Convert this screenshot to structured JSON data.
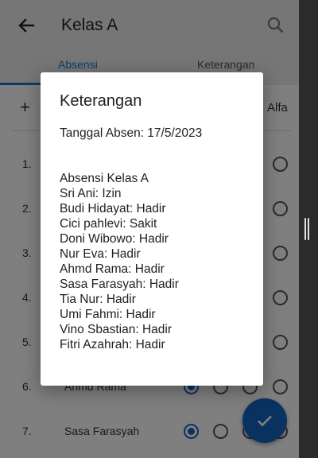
{
  "appbar": {
    "title": "Kelas A",
    "back_icon": "arrow-left-icon",
    "search_icon": "search-icon"
  },
  "tabs": [
    {
      "label": "Absensi",
      "active": true
    },
    {
      "label": "Keterangan",
      "active": false
    }
  ],
  "toolbar": {
    "add_symbol": "+",
    "alfa_label": "Alfa"
  },
  "list": {
    "rows": [
      {
        "num": "1.",
        "name": ""
      },
      {
        "num": "2.",
        "name": ""
      },
      {
        "num": "3.",
        "name": ""
      },
      {
        "num": "4.",
        "name": ""
      },
      {
        "num": "5.",
        "name": ""
      },
      {
        "num": "6.",
        "name": "Ahmd Rama"
      },
      {
        "num": "7.",
        "name": "Sasa Farasyah"
      }
    ]
  },
  "fab": {
    "icon": "check-icon",
    "color": "#1565c0"
  },
  "dialog": {
    "title": "Keterangan",
    "date_line": "Tanggal Absen: 17/5/2023",
    "body_heading": "Absensi Kelas A",
    "entries": [
      "Sri Ani: Izin",
      "Budi Hidayat: Hadir",
      "Cici pahlevi: Sakit",
      "Doni Wibowo: Hadir",
      "Nur Eva: Hadir",
      "Ahmd Rama: Hadir",
      "Sasa Farasyah: Hadir",
      "Tia Nur: Hadir",
      "Umi Fahmi: Hadir",
      "Vino Sbastian: Hadir",
      "Fitri Azahrah: Hadir"
    ]
  },
  "colors": {
    "accent": "#1976d2",
    "appbar_bg": "#ededed"
  }
}
